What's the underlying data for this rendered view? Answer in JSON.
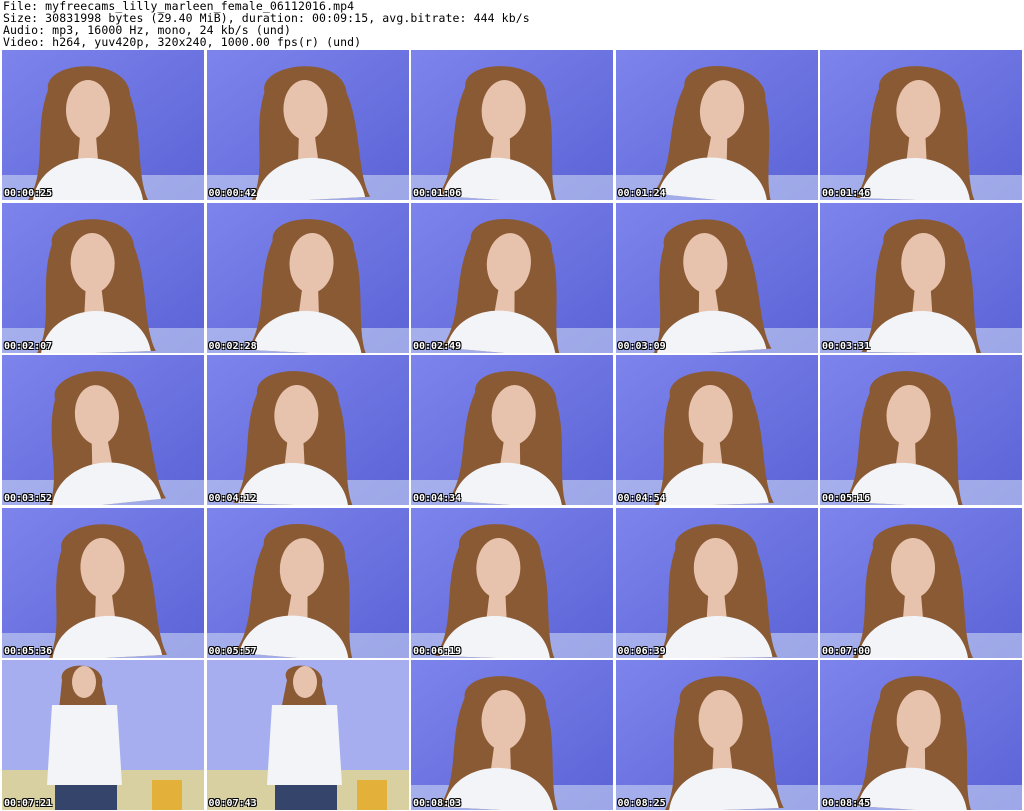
{
  "header": {
    "file_line": "File: myfreecams_lilly_marleen_female_06112016.mp4",
    "size_line": "Size: 30831998 bytes (29.40 MiB), duration: 00:09:15, avg.bitrate: 444 kb/s",
    "audio_line": "Audio: mp3, 16000 Hz, mono, 24 kb/s (und)",
    "video_line": "Video: h264, yuv420p, 320x240, 1000.00 fps(r) (und)"
  },
  "thumbnails": [
    {
      "timestamp": "00:00:25",
      "scene": "portrait"
    },
    {
      "timestamp": "00:00:42",
      "scene": "portrait"
    },
    {
      "timestamp": "00:01:06",
      "scene": "portrait"
    },
    {
      "timestamp": "00:01:24",
      "scene": "portrait"
    },
    {
      "timestamp": "00:01:46",
      "scene": "portrait"
    },
    {
      "timestamp": "00:02:07",
      "scene": "portrait"
    },
    {
      "timestamp": "00:02:28",
      "scene": "portrait"
    },
    {
      "timestamp": "00:02:49",
      "scene": "portrait"
    },
    {
      "timestamp": "00:03:09",
      "scene": "portrait"
    },
    {
      "timestamp": "00:03:31",
      "scene": "portrait"
    },
    {
      "timestamp": "00:03:52",
      "scene": "portrait"
    },
    {
      "timestamp": "00:04:12",
      "scene": "portrait"
    },
    {
      "timestamp": "00:04:34",
      "scene": "portrait"
    },
    {
      "timestamp": "00:04:54",
      "scene": "portrait"
    },
    {
      "timestamp": "00:05:16",
      "scene": "portrait"
    },
    {
      "timestamp": "00:05:36",
      "scene": "portrait"
    },
    {
      "timestamp": "00:05:57",
      "scene": "portrait"
    },
    {
      "timestamp": "00:06:19",
      "scene": "portrait"
    },
    {
      "timestamp": "00:06:39",
      "scene": "portrait"
    },
    {
      "timestamp": "00:07:00",
      "scene": "portrait"
    },
    {
      "timestamp": "00:07:21",
      "scene": "standing"
    },
    {
      "timestamp": "00:07:43",
      "scene": "standing"
    },
    {
      "timestamp": "00:08:03",
      "scene": "portrait"
    },
    {
      "timestamp": "00:08:25",
      "scene": "portrait"
    },
    {
      "timestamp": "00:08:45",
      "scene": "portrait"
    }
  ],
  "colors": {
    "background_wall": "#6f78e6",
    "hair": "#8a5a34",
    "skin": "#e7c2ad",
    "top": "#f2f4f8",
    "timestamp_text": "#ffffff"
  }
}
